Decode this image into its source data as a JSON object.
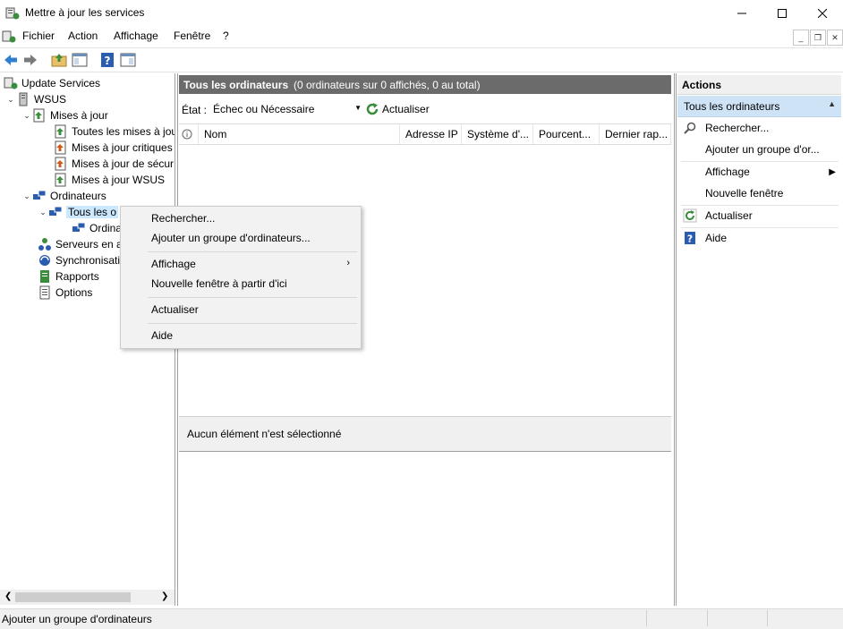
{
  "window": {
    "title": "Mettre à jour les services"
  },
  "menubar": [
    "Fichier",
    "Action",
    "Affichage",
    "Fenêtre",
    "?"
  ],
  "tree": {
    "root": "Update Services",
    "server": "WSUS",
    "updates": "Mises à jour",
    "all_updates": "Toutes les mises à jou",
    "critical": "Mises à jour critiques",
    "security": "Mises à jour de sécur",
    "wsus_updates": "Mises à jour WSUS",
    "computers": "Ordinateurs",
    "all_computers": "Tous les o",
    "ordina": "Ordina",
    "downstream": "Serveurs en a",
    "sync": "Synchronisati",
    "reports": "Rapports",
    "options": "Options"
  },
  "center": {
    "header_title": "Tous les ordinateurs",
    "header_count": "(0 ordinateurs sur 0 affichés, 0 au total)",
    "state_label": "État :",
    "state_value": "Échec ou Nécessaire",
    "refresh_label": "Actualiser",
    "columns": [
      "Nom",
      "Adresse IP",
      "Système d'...",
      "Pourcent...",
      "Dernier rap..."
    ],
    "details_text": "Aucun élément n'est sélectionné"
  },
  "actions": {
    "header": "Actions",
    "section": "Tous les ordinateurs",
    "items": [
      "Rechercher...",
      "Ajouter un groupe d'or...",
      "Affichage",
      "Nouvelle fenêtre",
      "Actualiser",
      "Aide"
    ]
  },
  "context_menu": {
    "items": [
      "Rechercher...",
      "Ajouter un groupe d'ordinateurs...",
      "Affichage",
      "Nouvelle fenêtre à partir d'ici",
      "Actualiser",
      "Aide"
    ]
  },
  "status": {
    "text": "Ajouter un groupe d'ordinateurs"
  },
  "colors": {
    "accent": "#cce8ff",
    "header_bg": "#6b6b6b",
    "action_section_bg": "#cfe3f6"
  }
}
